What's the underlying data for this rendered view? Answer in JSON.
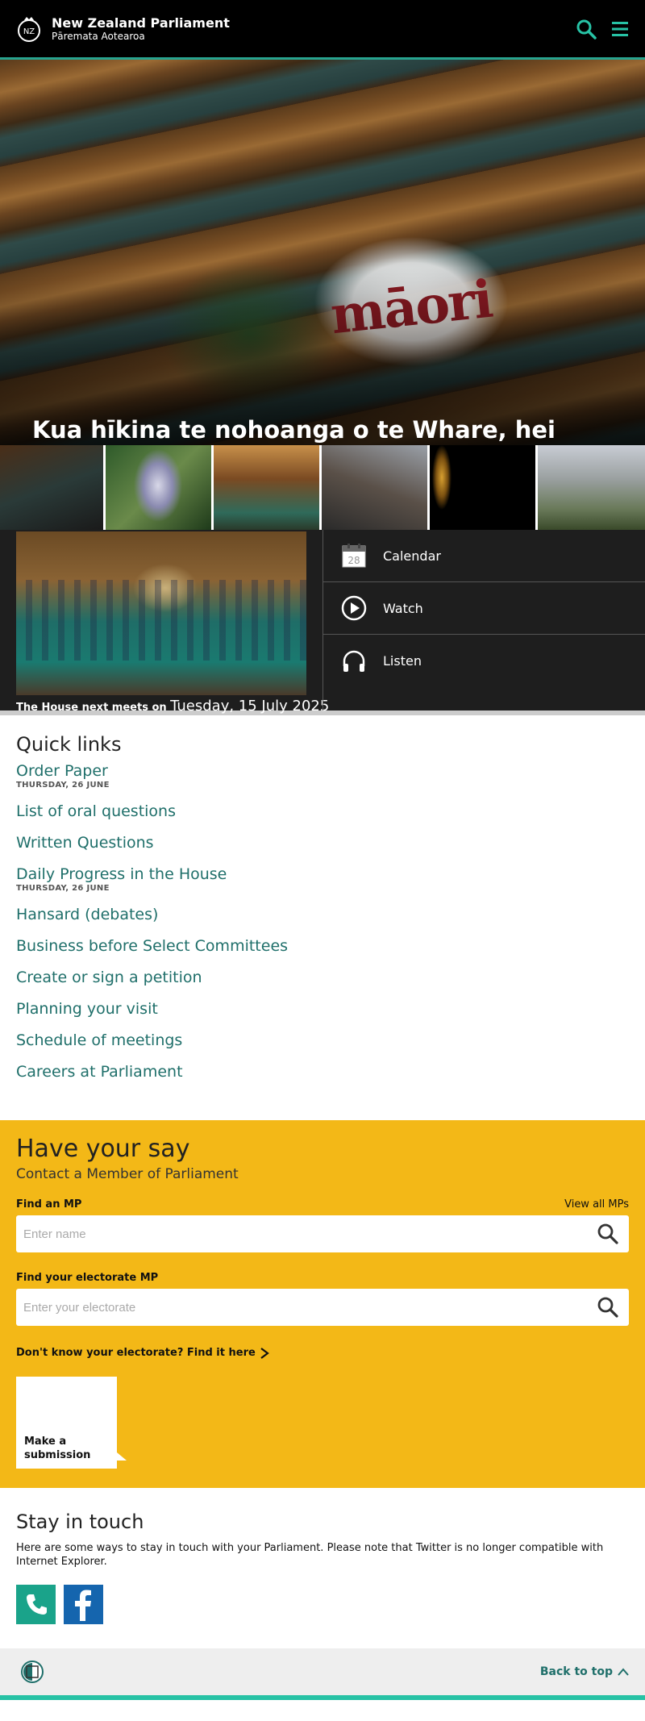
{
  "header": {
    "title": "New Zealand Parliament",
    "subtitle": "Pāremata Aotearoa"
  },
  "hero": {
    "title": "Kua hīkina te nohoanga o te Whare, hei tohu whakamahara ki a MP Takutai Tarsh Kemp",
    "flag_text": "māori"
  },
  "house": {
    "caption_prefix": "The House next meets on",
    "date": "Tuesday, 15 July 2025",
    "links": [
      {
        "label": "Calendar",
        "icon": "calendar-icon",
        "calendar_day": "28"
      },
      {
        "label": "Watch",
        "icon": "play-icon"
      },
      {
        "label": "Listen",
        "icon": "headphones-icon"
      }
    ]
  },
  "quick_links": {
    "title": "Quick links",
    "items": [
      {
        "label": "Order Paper",
        "date": "THURSDAY, 26 JUNE"
      },
      {
        "label": "List of oral questions"
      },
      {
        "label": "Written Questions"
      },
      {
        "label": "Daily Progress in the House",
        "date": "THURSDAY, 26 JUNE"
      },
      {
        "label": "Hansard (debates)"
      },
      {
        "label": "Business before Select Committees"
      },
      {
        "label": "Create or sign a petition"
      },
      {
        "label": "Planning your visit"
      },
      {
        "label": "Schedule of meetings"
      },
      {
        "label": "Careers at Parliament"
      }
    ]
  },
  "say": {
    "title": "Have your say",
    "subtitle": "Contact a Member of Parliament",
    "find_mp_label": "Find an MP",
    "view_all": "View all MPs",
    "find_mp_placeholder": "Enter name",
    "electorate_label": "Find your electorate MP",
    "electorate_placeholder": "Enter your electorate",
    "find_it": "Don't know your electorate? Find it here",
    "submission": "Make a submission"
  },
  "touch": {
    "title": "Stay in touch",
    "text": "Here are some ways to stay in touch with your Parliament. Please note that Twitter is no longer compatible with Internet Explorer."
  },
  "footer": {
    "back_to_top": "Back to top"
  },
  "colors": {
    "accent": "#27a38f",
    "link": "#1f6f6a",
    "say_bg": "#f3b817",
    "facebook": "#1565ae"
  }
}
